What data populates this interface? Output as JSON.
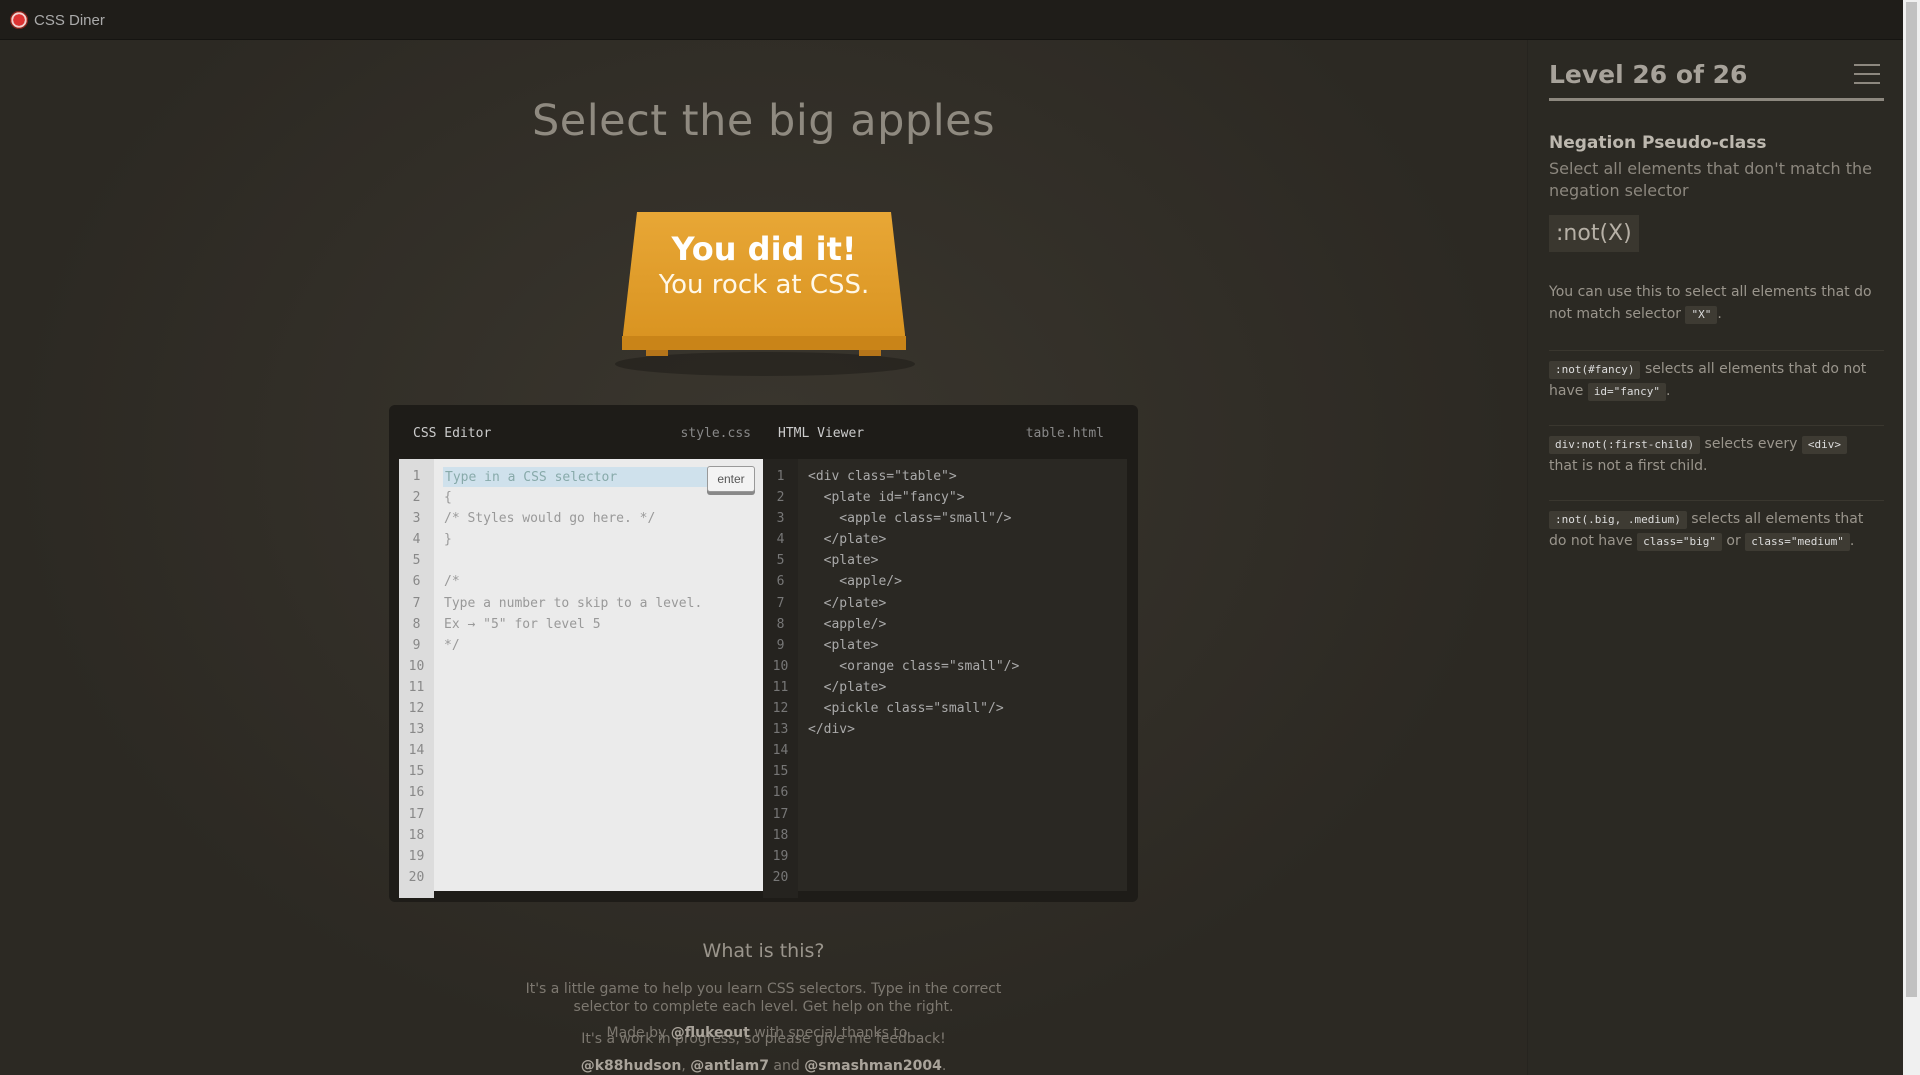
{
  "app": {
    "title": "CSS Diner"
  },
  "order": "Select the big apples",
  "win": {
    "line1": "You did it!",
    "line2": "You rock at CSS."
  },
  "editor": {
    "css_title": "CSS Editor",
    "css_file": "style.css",
    "html_title": "HTML Viewer",
    "html_file": "table.html",
    "input_placeholder": "Type in a CSS selector",
    "enter_label": "enter",
    "line_numbers": [
      "1",
      "2",
      "3",
      "4",
      "5",
      "6",
      "7",
      "8",
      "9",
      "10",
      "11",
      "12",
      "13",
      "14",
      "15",
      "16",
      "17",
      "18",
      "19",
      "20"
    ],
    "css_lines": [
      "",
      "{",
      "/* Styles would go here. */",
      "}",
      "",
      "/*",
      "Type a number to skip to a level.",
      "Ex → \"5\" for level 5",
      "*/"
    ],
    "html_lines": [
      "<div class=\"table\">",
      "  <plate id=\"fancy\">",
      "    <apple class=\"small\"/>",
      "  </plate>",
      "  <plate>",
      "    <apple/>",
      "  </plate>",
      "  <apple/>",
      "  <plate>",
      "    <orange class=\"small\"/>",
      "  </plate>",
      "  <pickle class=\"small\"/>",
      "</div>"
    ]
  },
  "about": {
    "title": "What is this?",
    "p1a": "It's a little game to help you learn CSS selectors. Type in the correct",
    "p1b": "selector to complete each level. Get help on the right.",
    "p2": "It's a work in progress, so please give me feedback!",
    "p3_pre": "Made by",
    "p3_author": "@flukeout",
    "p3_post": "with special thanks to...",
    "thanks1": "@k88hudson",
    "thanks2": "@antlam7",
    "thanks_and": "and",
    "thanks3": "@smashman2004"
  },
  "sidebar": {
    "level": "Level 26 of 26",
    "progress": 1.0,
    "selector_name": "Negation Pseudo-class",
    "title": "Select all elements that don't match the negation selector",
    "syntax": ":not(X)",
    "hint_a": "You can use this to select all elements that do not match selector",
    "hint_tag": "\"X\"",
    "ex1_tag": ":not(#fancy)",
    "ex1_text": "selects all elements that do not have",
    "ex1_tag2": "id=\"fancy\"",
    "ex2_tag": "div:not(:first-child)",
    "ex2_text": "selects every",
    "ex2_tag2": "<div>",
    "ex2_text2": "that is not a first child.",
    "ex3_tag": ":not(.big, .medium)",
    "ex3_text": "selects all elements that do not have",
    "ex3_tag2": "class=\"big\"",
    "ex3_or": "or",
    "ex3_tag3": "class=\"medium\""
  }
}
